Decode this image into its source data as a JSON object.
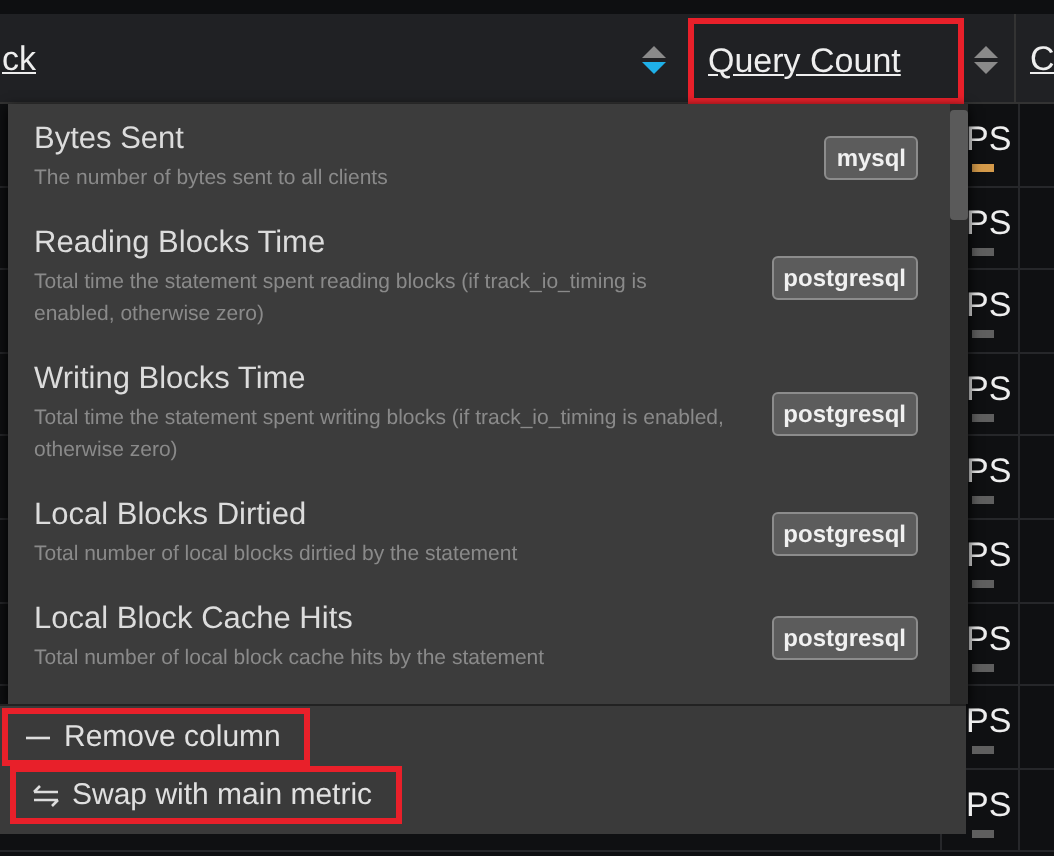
{
  "header": {
    "left_label": "ck",
    "left_sorted_descending": true,
    "active_column": {
      "label": "Query Count",
      "sorted_descending": false,
      "highlighted": true
    },
    "next_label": "C"
  },
  "rows": [
    {
      "text": "PS",
      "color": "#d49a4a"
    },
    {
      "text": "PS",
      "color": "#5f5f5f"
    },
    {
      "text": "PS",
      "color": "#5f5f5f"
    },
    {
      "text": "PS",
      "color": "#5f5f5f"
    },
    {
      "text": "PS",
      "color": "#5f5f5f"
    },
    {
      "text": "PS",
      "color": "#5f5f5f"
    },
    {
      "text": "PS",
      "color": "#5f5f5f"
    },
    {
      "text": "PS",
      "color": "#5f5f5f"
    },
    {
      "text": "PS",
      "color": "#5f5f5f"
    }
  ],
  "menu": {
    "items": [
      {
        "title": "Bytes Sent",
        "description": "The number of bytes sent to all clients",
        "tag": "mysql"
      },
      {
        "title": "Reading Blocks Time",
        "description": "Total time the statement spent reading blocks (if track_io_timing is enabled, otherwise zero)",
        "tag": "postgresql"
      },
      {
        "title": "Writing Blocks Time",
        "description": "Total time the statement spent writing blocks (if track_io_timing is enabled, otherwise zero)",
        "tag": "postgresql"
      },
      {
        "title": "Local Blocks Dirtied",
        "description": "Total number of local blocks dirtied by the statement",
        "tag": "postgresql"
      },
      {
        "title": "Local Block Cache Hits",
        "description": "Total number of local block cache hits by the statement",
        "tag": "postgresql"
      }
    ],
    "actions": [
      {
        "kind": "remove",
        "label": "Remove column",
        "highlighted": true
      },
      {
        "kind": "swap",
        "label": "Swap with main metric",
        "highlighted": true
      }
    ]
  }
}
